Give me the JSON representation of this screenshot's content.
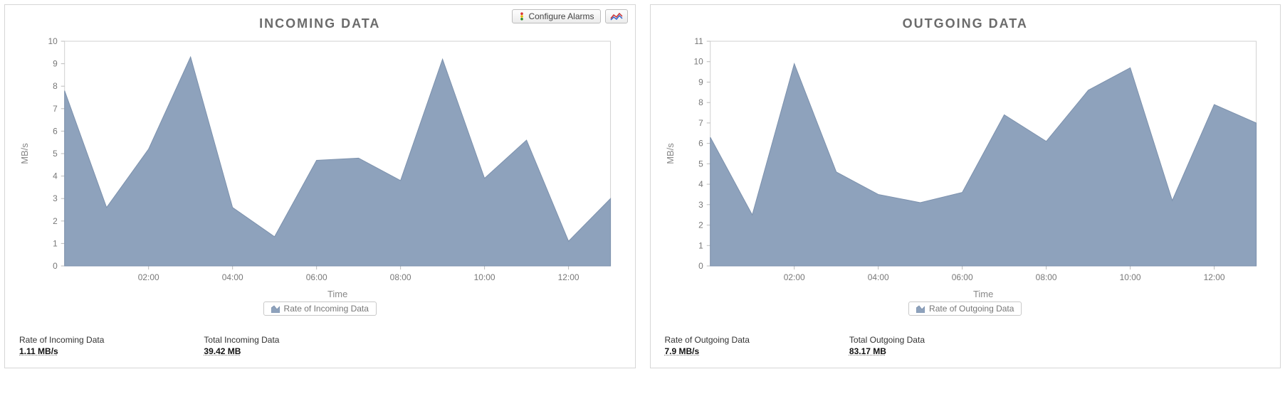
{
  "panels": [
    {
      "id": "incoming",
      "title": "INCOMING DATA",
      "toolbar": {
        "configure_label": "Configure Alarms"
      },
      "legend": "Rate of Incoming Data",
      "stats": [
        {
          "label": "Rate of Incoming Data",
          "value": "1.11 MB/s"
        },
        {
          "label": "Total Incoming Data",
          "value": "39.42 MB"
        }
      ]
    },
    {
      "id": "outgoing",
      "title": "OUTGOING DATA",
      "legend": "Rate of Outgoing Data",
      "stats": [
        {
          "label": "Rate of Outgoing Data",
          "value": "7.9 MB/s"
        },
        {
          "label": "Total Outgoing Data",
          "value": "83.17 MB"
        }
      ]
    }
  ],
  "chart_data": [
    {
      "type": "area",
      "title": "INCOMING DATA",
      "xlabel": "Time",
      "ylabel": "MB/s",
      "ylim": [
        0,
        10
      ],
      "yticks": [
        0,
        1,
        2,
        3,
        4,
        5,
        6,
        7,
        8,
        9,
        10
      ],
      "xticks": [
        "02:00",
        "04:00",
        "06:00",
        "08:00",
        "10:00",
        "12:00"
      ],
      "series": [
        {
          "name": "Rate of Incoming Data",
          "x": [
            "00:00",
            "01:00",
            "02:00",
            "03:00",
            "04:00",
            "05:00",
            "06:00",
            "07:00",
            "08:00",
            "09:00",
            "10:00",
            "11:00",
            "12:00",
            "13:00"
          ],
          "values": [
            7.8,
            2.6,
            5.2,
            9.3,
            2.6,
            1.3,
            4.7,
            4.8,
            3.8,
            9.2,
            3.9,
            5.6,
            1.1,
            3.0
          ]
        }
      ]
    },
    {
      "type": "area",
      "title": "OUTGOING DATA",
      "xlabel": "Time",
      "ylabel": "MB/s",
      "ylim": [
        0,
        11
      ],
      "yticks": [
        0,
        1,
        2,
        3,
        4,
        5,
        6,
        7,
        8,
        9,
        10,
        11
      ],
      "xticks": [
        "02:00",
        "04:00",
        "06:00",
        "08:00",
        "10:00",
        "12:00"
      ],
      "series": [
        {
          "name": "Rate of Outgoing Data",
          "x": [
            "00:00",
            "01:00",
            "02:00",
            "03:00",
            "04:00",
            "05:00",
            "06:00",
            "07:00",
            "08:00",
            "09:00",
            "10:00",
            "11:00",
            "12:00",
            "13:00"
          ],
          "values": [
            6.3,
            2.5,
            9.9,
            4.6,
            3.5,
            3.1,
            3.6,
            7.4,
            6.1,
            8.6,
            9.7,
            3.2,
            7.9,
            7.0
          ]
        }
      ]
    }
  ],
  "colors": {
    "area": "#8ea2bc",
    "areaStroke": "#7c91ad"
  }
}
